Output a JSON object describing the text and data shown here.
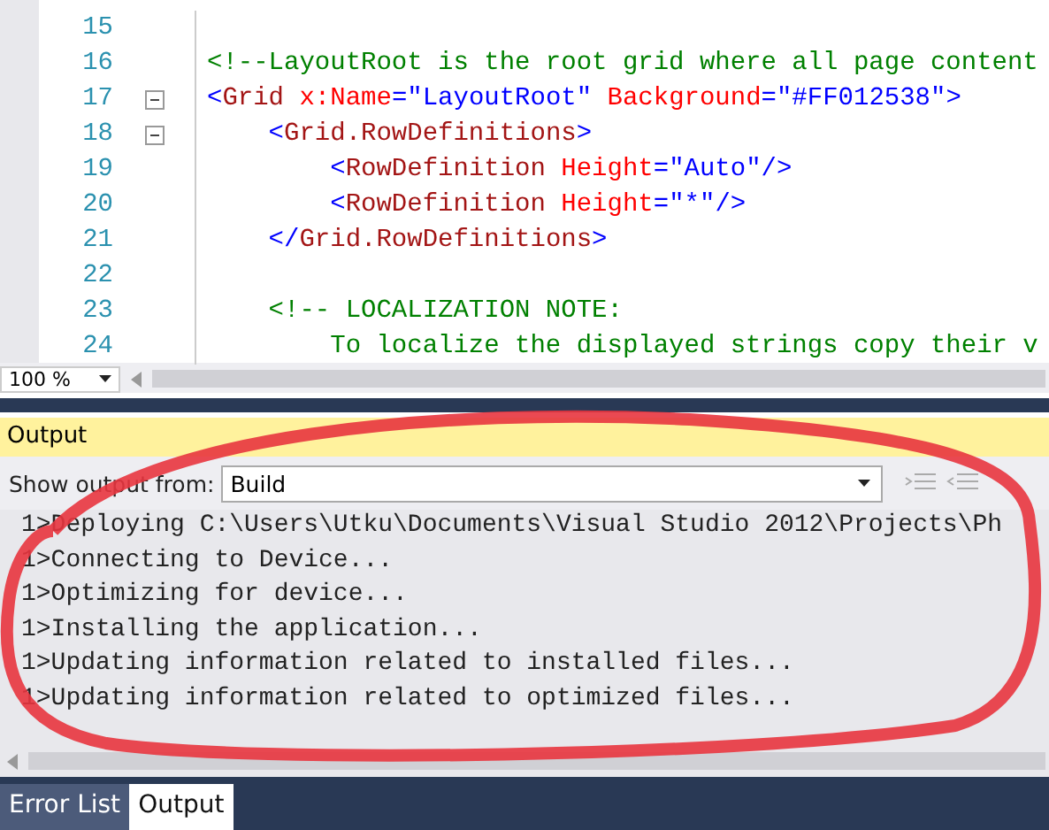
{
  "editor": {
    "lines": [
      {
        "number": "15",
        "collapsible": false
      },
      {
        "number": "16",
        "collapsible": false,
        "tokens": [
          {
            "kind": "comment",
            "text": "<!--LayoutRoot is the root grid where all page content"
          }
        ]
      },
      {
        "number": "17",
        "collapsible": true,
        "tokens": [
          {
            "kind": "punct",
            "text": "<"
          },
          {
            "kind": "tag",
            "text": "Grid"
          },
          {
            "kind": "attr",
            "text": " x:Name"
          },
          {
            "kind": "punct",
            "text": "="
          },
          {
            "kind": "value",
            "text": "\"LayoutRoot\""
          },
          {
            "kind": "attr",
            "text": " Background"
          },
          {
            "kind": "punct",
            "text": "="
          },
          {
            "kind": "value",
            "text": "\"#FF012538\""
          },
          {
            "kind": "punct",
            "text": ">"
          }
        ]
      },
      {
        "number": "18",
        "collapsible": true,
        "tokens": [
          {
            "kind": "punct",
            "text": "    <"
          },
          {
            "kind": "tag",
            "text": "Grid.RowDefinitions"
          },
          {
            "kind": "punct",
            "text": ">"
          }
        ]
      },
      {
        "number": "19",
        "collapsible": false,
        "tokens": [
          {
            "kind": "punct",
            "text": "        <"
          },
          {
            "kind": "tag",
            "text": "RowDefinition"
          },
          {
            "kind": "attr",
            "text": " Height"
          },
          {
            "kind": "punct",
            "text": "="
          },
          {
            "kind": "value",
            "text": "\"Auto\""
          },
          {
            "kind": "punct",
            "text": "/>"
          }
        ]
      },
      {
        "number": "20",
        "collapsible": false,
        "tokens": [
          {
            "kind": "punct",
            "text": "        <"
          },
          {
            "kind": "tag",
            "text": "RowDefinition"
          },
          {
            "kind": "attr",
            "text": " Height"
          },
          {
            "kind": "punct",
            "text": "="
          },
          {
            "kind": "value",
            "text": "\"*\""
          },
          {
            "kind": "punct",
            "text": "/>"
          }
        ]
      },
      {
        "number": "21",
        "collapsible": false,
        "tokens": [
          {
            "kind": "punct",
            "text": "    </"
          },
          {
            "kind": "tag",
            "text": "Grid.RowDefinitions"
          },
          {
            "kind": "punct",
            "text": ">"
          }
        ]
      },
      {
        "number": "22",
        "collapsible": false
      },
      {
        "number": "23",
        "collapsible": false,
        "tokens": [
          {
            "kind": "comment",
            "text": "    <!-- LOCALIZATION NOTE:"
          }
        ]
      },
      {
        "number": "24",
        "collapsible": false,
        "tokens": [
          {
            "kind": "comment",
            "text": "        To localize the displayed strings copy their v"
          }
        ]
      }
    ],
    "zoom": "100 %"
  },
  "output": {
    "title": "Output",
    "show_output_label": "Show output from:",
    "source": "Build",
    "lines": [
      "1>Deploying C:\\Users\\Utku\\Documents\\Visual Studio 2012\\Projects\\Ph",
      "1>Connecting to Device...",
      "1>Optimizing for device...",
      "1>Installing the application...",
      "1>Updating information related to installed files...",
      "1>Updating information related to optimized files..."
    ]
  },
  "tabs": [
    {
      "label": "Error List",
      "selected": false
    },
    {
      "label": "Output",
      "selected": true
    }
  ]
}
